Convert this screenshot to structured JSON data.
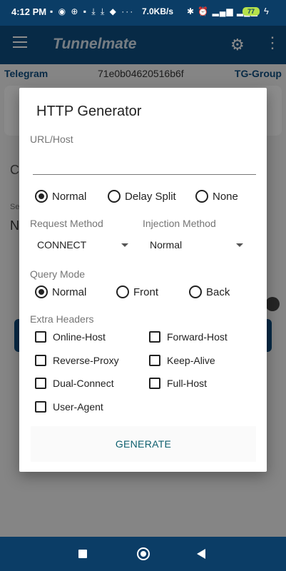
{
  "status_bar": {
    "time": "4:12 PM",
    "speed": "7.0KB/s",
    "battery": "77",
    "dots": "···"
  },
  "app_bar": {
    "title": "Tunnelmate"
  },
  "background": {
    "link_left": "Telegram",
    "link_mid": "71e0b04620516b6f",
    "link_right": "TG-Group",
    "line1": "C",
    "line2": "Se",
    "line3": "N"
  },
  "dialog": {
    "title": "HTTP Generator",
    "url_label": "URL/Host",
    "url_value": "",
    "split_options": [
      {
        "label": "Normal",
        "selected": true
      },
      {
        "label": "Delay Split",
        "selected": false
      },
      {
        "label": "None",
        "selected": false
      }
    ],
    "request_method_label": "Request Method",
    "request_method_value": "CONNECT",
    "injection_method_label": "Injection Method",
    "injection_method_value": "Normal",
    "query_mode_label": "Query Mode",
    "query_options": [
      {
        "label": "Normal",
        "selected": true
      },
      {
        "label": "Front",
        "selected": false
      },
      {
        "label": "Back",
        "selected": false
      }
    ],
    "extra_headers_label": "Extra Headers",
    "headers": [
      {
        "label": "Online-Host",
        "checked": false
      },
      {
        "label": "Forward-Host",
        "checked": false
      },
      {
        "label": "Reverse-Proxy",
        "checked": false
      },
      {
        "label": "Keep-Alive",
        "checked": false
      },
      {
        "label": "Dual-Connect",
        "checked": false
      },
      {
        "label": "Full-Host",
        "checked": false
      },
      {
        "label": "User-Agent",
        "checked": false
      }
    ],
    "generate_label": "GENERATE"
  }
}
